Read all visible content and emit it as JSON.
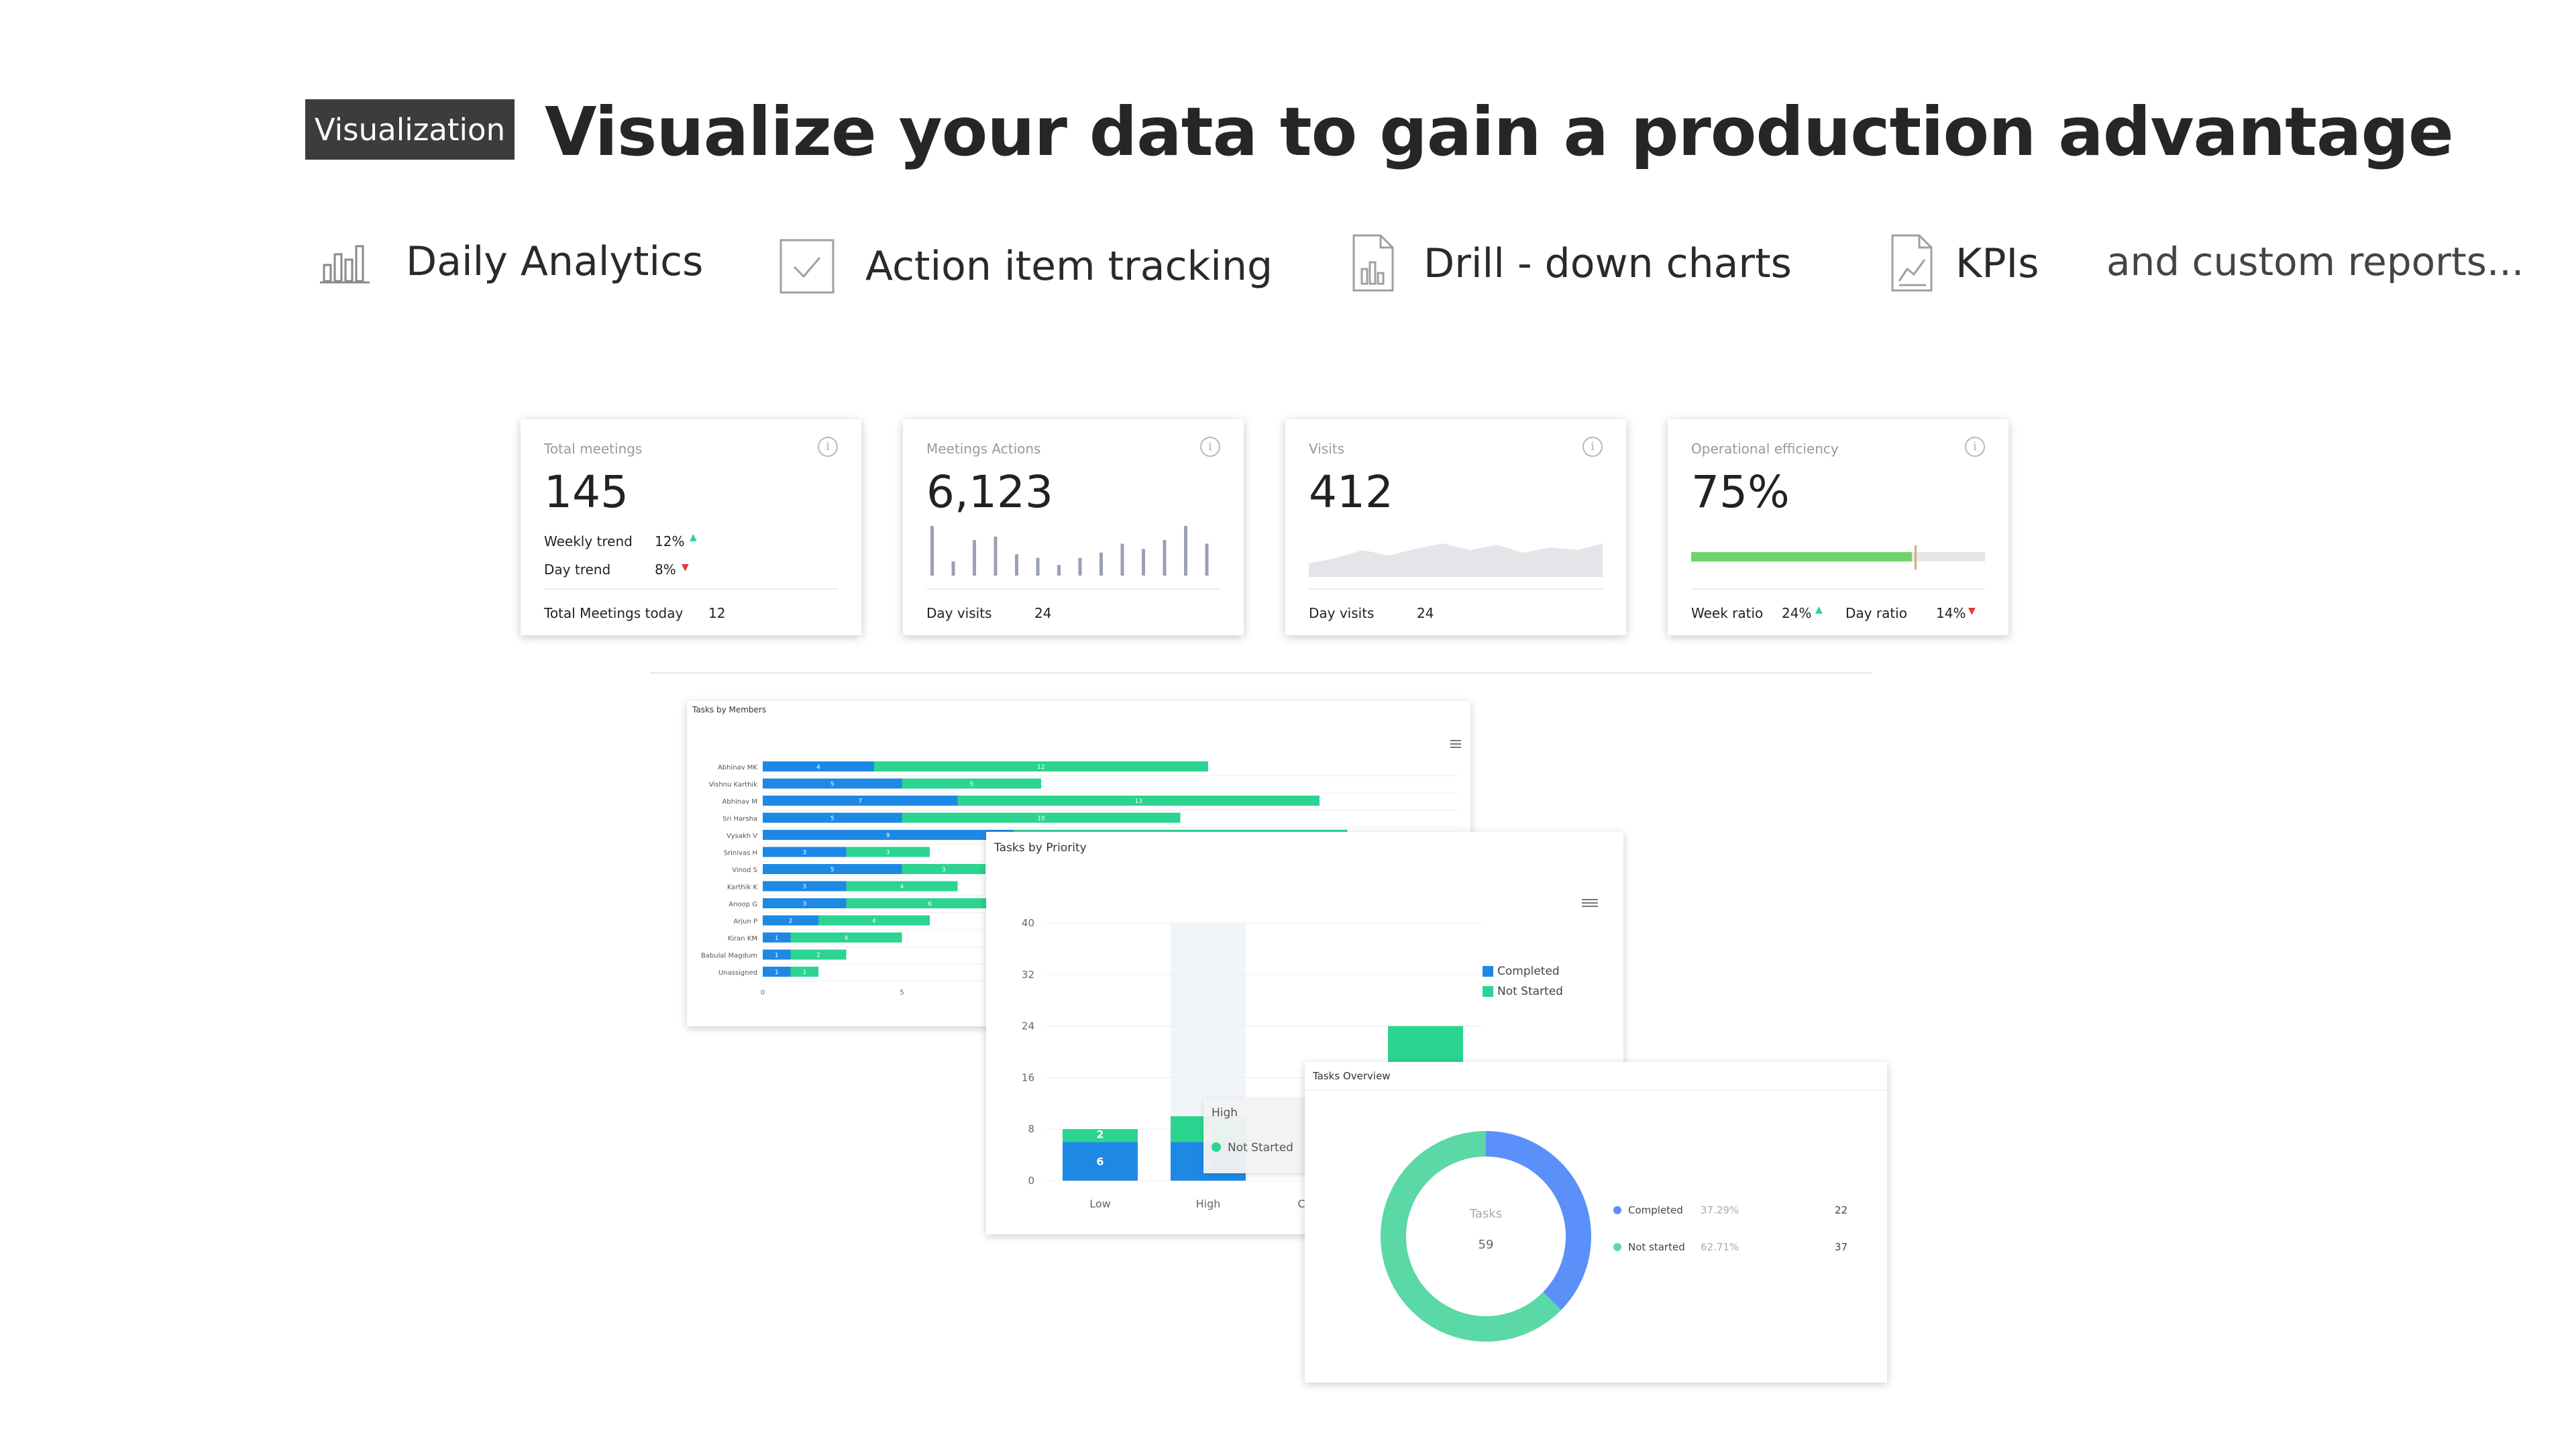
{
  "header": {
    "badge": "Visualization",
    "headline": "Visualize your data to gain a production advantage"
  },
  "features": [
    {
      "label": "Daily Analytics",
      "icon": "bar-chart-icon"
    },
    {
      "label": "Action item tracking",
      "icon": "checkbox-icon"
    },
    {
      "label": "Drill - down charts",
      "icon": "document-chart-icon"
    },
    {
      "label": "KPIs",
      "icon": "trend-document-icon"
    }
  ],
  "custom_reports": "and custom reports...",
  "kpi_cards": {
    "total_meetings": {
      "title": "Total meetings",
      "value": "145",
      "weekly_label": "Weekly trend",
      "weekly_value": "12%",
      "day_label": "Day trend",
      "day_value": "8%",
      "footer_label": "Total Meetings today",
      "footer_value": "12"
    },
    "meetings_actions": {
      "title": "Meetings Actions",
      "value": "6,123",
      "footer_label": "Day visits",
      "footer_value": "24",
      "sparkbars": [
        28,
        8,
        20,
        22,
        12,
        10,
        6,
        10,
        13,
        18,
        15,
        20,
        28,
        18
      ]
    },
    "visits": {
      "title": "Visits",
      "value": "412",
      "footer_label": "Day visits",
      "footer_value": "24"
    },
    "operational_efficiency": {
      "title": "Operational efficiency",
      "value": "75%",
      "progress": 0.75,
      "week_label": "Week ratio",
      "week_value": "24%",
      "day_label": "Day ratio",
      "day_value": "14%"
    }
  },
  "colors": {
    "completed": "#1e88e5",
    "not_started": "#2bd48f",
    "donut_completed": "#5b8ff9",
    "donut_not_started": "#5ad8a6",
    "up": "#2bd48f",
    "down": "#e53935"
  },
  "chart_data": [
    {
      "type": "bar",
      "title": "Tasks by Members",
      "orientation": "horizontal",
      "stacked": true,
      "categories": [
        "Abhinav MK",
        "Vishnu Karthik",
        "Abhinav M",
        "Sri Harsha",
        "Vysakh V",
        "Srinivas H",
        "Vinod S",
        "Karthik K",
        "Anoop G",
        "Arjun P",
        "Kiran KM",
        "Babulal Magdum",
        "Unassigned"
      ],
      "series": [
        {
          "name": "Completed",
          "values": [
            4,
            5,
            7,
            5,
            9,
            3,
            5,
            3,
            3,
            2,
            1,
            1,
            1
          ]
        },
        {
          "name": "Not Started",
          "values": [
            12,
            5,
            13,
            10,
            12,
            3,
            3,
            4,
            6,
            4,
            4,
            2,
            1
          ]
        }
      ],
      "xticks": [
        "0",
        "5"
      ]
    },
    {
      "type": "bar",
      "title": "Tasks by Priority",
      "stacked": true,
      "categories": [
        "Low",
        "High",
        "C"
      ],
      "series": [
        {
          "name": "Completed",
          "values": [
            6,
            6,
            0
          ]
        },
        {
          "name": "Not Started",
          "values": [
            2,
            4,
            24
          ]
        }
      ],
      "yticks": [
        "40",
        "32",
        "24",
        "16",
        "8",
        "0"
      ],
      "ylim": [
        0,
        40
      ],
      "legend": "right",
      "tooltip": {
        "title": "High",
        "item": "Not Started"
      }
    },
    {
      "type": "pie",
      "title": "Tasks Overview",
      "center_label": "Tasks",
      "center_value": "59",
      "slices": [
        {
          "name": "Completed",
          "percent": "37.29%",
          "value": 22
        },
        {
          "name": "Not started",
          "percent": "62.71%",
          "value": 37
        }
      ],
      "legend": "right"
    }
  ]
}
